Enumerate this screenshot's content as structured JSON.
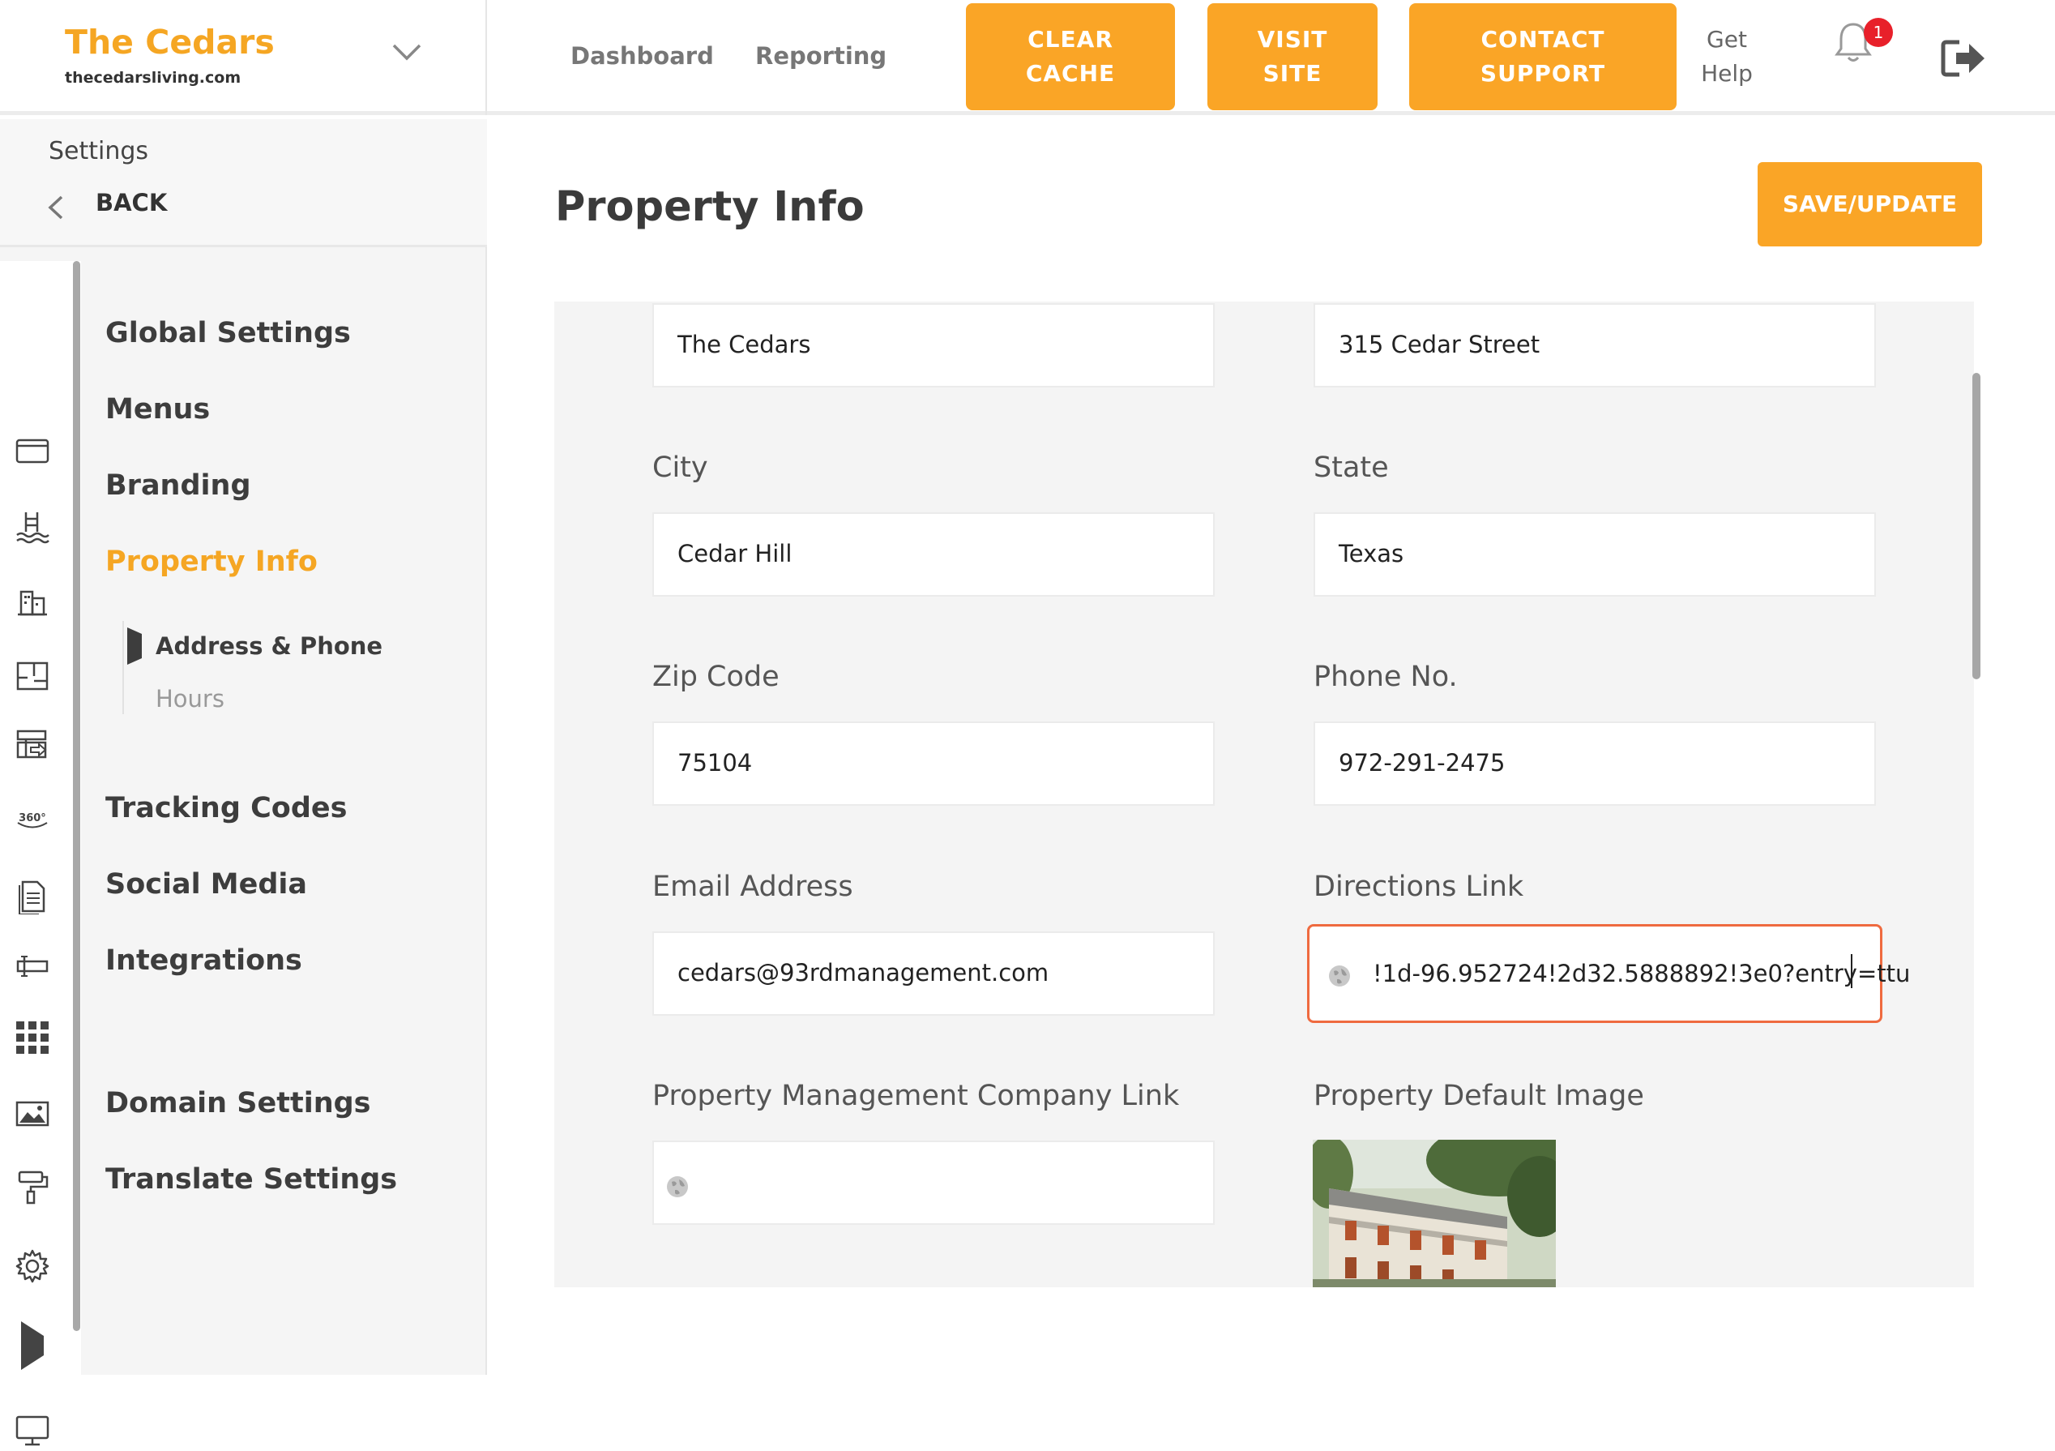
{
  "brand": {
    "name": "The Cedars",
    "url": "thecedarsliving.com"
  },
  "nav": {
    "dashboard": "Dashboard",
    "reporting": "Reporting"
  },
  "buttons": {
    "clear_cache_line1": "CLEAR",
    "clear_cache_line2": "CACHE",
    "visit_site_line1": "VISIT",
    "visit_site_line2": "SITE",
    "contact_support_line1": "CONTACT",
    "contact_support_line2": "SUPPORT",
    "get_help_line1": "Get",
    "get_help_line2": "Help"
  },
  "notifications": {
    "count": "1"
  },
  "sidebar": {
    "section_title": "Settings",
    "back_label": "BACK",
    "items": [
      {
        "label": "Global Settings"
      },
      {
        "label": "Menus"
      },
      {
        "label": "Branding"
      },
      {
        "label": "Property Info"
      },
      {
        "label": "Tracking Codes"
      },
      {
        "label": "Social Media"
      },
      {
        "label": "Integrations"
      },
      {
        "label": "Domain Settings"
      },
      {
        "label": "Translate Settings"
      }
    ],
    "subitems": [
      {
        "label": "Address & Phone"
      },
      {
        "label": "Hours"
      }
    ],
    "rail_icons": [
      "browser-window-icon",
      "pool-icon",
      "buildings-icon",
      "floorplan-icon",
      "layout-icon",
      "360-view-icon",
      "document-icon",
      "input-field-icon",
      "grid-icon",
      "image-icon",
      "paint-roller-icon",
      "gear-icon",
      "play-marker-icon",
      "monitor-icon"
    ]
  },
  "page": {
    "title": "Property Info",
    "save_label": "SAVE/UPDATE"
  },
  "form": {
    "property_name": {
      "value": "The Cedars"
    },
    "street": {
      "value": "315 Cedar Street"
    },
    "city": {
      "label": "City",
      "value": "Cedar Hill"
    },
    "state": {
      "label": "State",
      "value": "Texas"
    },
    "zip": {
      "label": "Zip Code",
      "value": "75104"
    },
    "phone": {
      "label": "Phone No.",
      "value": "972-291-2475"
    },
    "email": {
      "label": "Email Address",
      "value": "cedars@93rdmanagement.com"
    },
    "directions": {
      "label": "Directions Link",
      "value": "!1d-96.952724!2d32.5888892!3e0?entry=ttu"
    },
    "pm_link": {
      "label": "Property Management Company Link",
      "value": ""
    },
    "default_image": {
      "label": "Property Default Image"
    }
  },
  "colors": {
    "accent": "#faa526",
    "brand_text": "#f5a623",
    "focus_border": "#ef6a3f",
    "badge": "#e8202a"
  }
}
